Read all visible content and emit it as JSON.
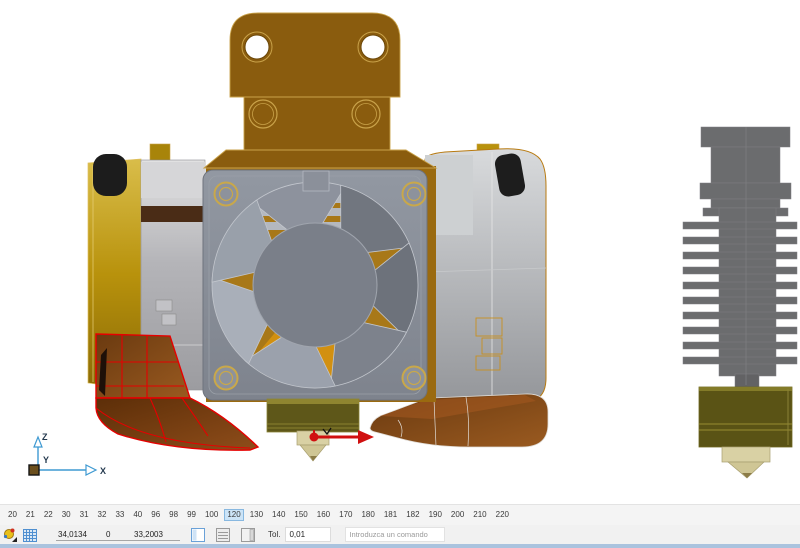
{
  "colors": {
    "selection_red": "#e60000",
    "bronze_bracket": "#8a5c0e",
    "gold_plate": "#b8920c",
    "amber_heatsink": "#a87818",
    "fan_gray": "#878c96",
    "duct_brown": "#8a4716",
    "heater_olive": "#5e5719",
    "nozzle_brass": "#d9d1a4",
    "axis_blue": "#3f9ad2",
    "ruler_highlight_bg": "#cce4f7",
    "ruler_highlight_border": "#88b8e0",
    "statusbar_bg": "#f1f1f1",
    "window_edge_blue": "#aac3de"
  },
  "viewport": {
    "axis_triad": {
      "x_label": "X",
      "y_label": "Y",
      "z_label": "Z"
    }
  },
  "ruler": {
    "values": [
      "20",
      "21",
      "22",
      "30",
      "31",
      "32",
      "33",
      "40",
      "96",
      "98",
      "99",
      "100",
      "120",
      "130",
      "140",
      "150",
      "160",
      "170",
      "180",
      "181",
      "182",
      "190",
      "200",
      "210",
      "220"
    ],
    "highlighted": "120"
  },
  "statusbar": {
    "coord_x": "34,0134",
    "coord_y": "0",
    "coord_z": "33,2003",
    "tolerance_label": "Tol.",
    "tolerance_value": "0,01",
    "command_placeholder": "Introduzca un comando"
  }
}
